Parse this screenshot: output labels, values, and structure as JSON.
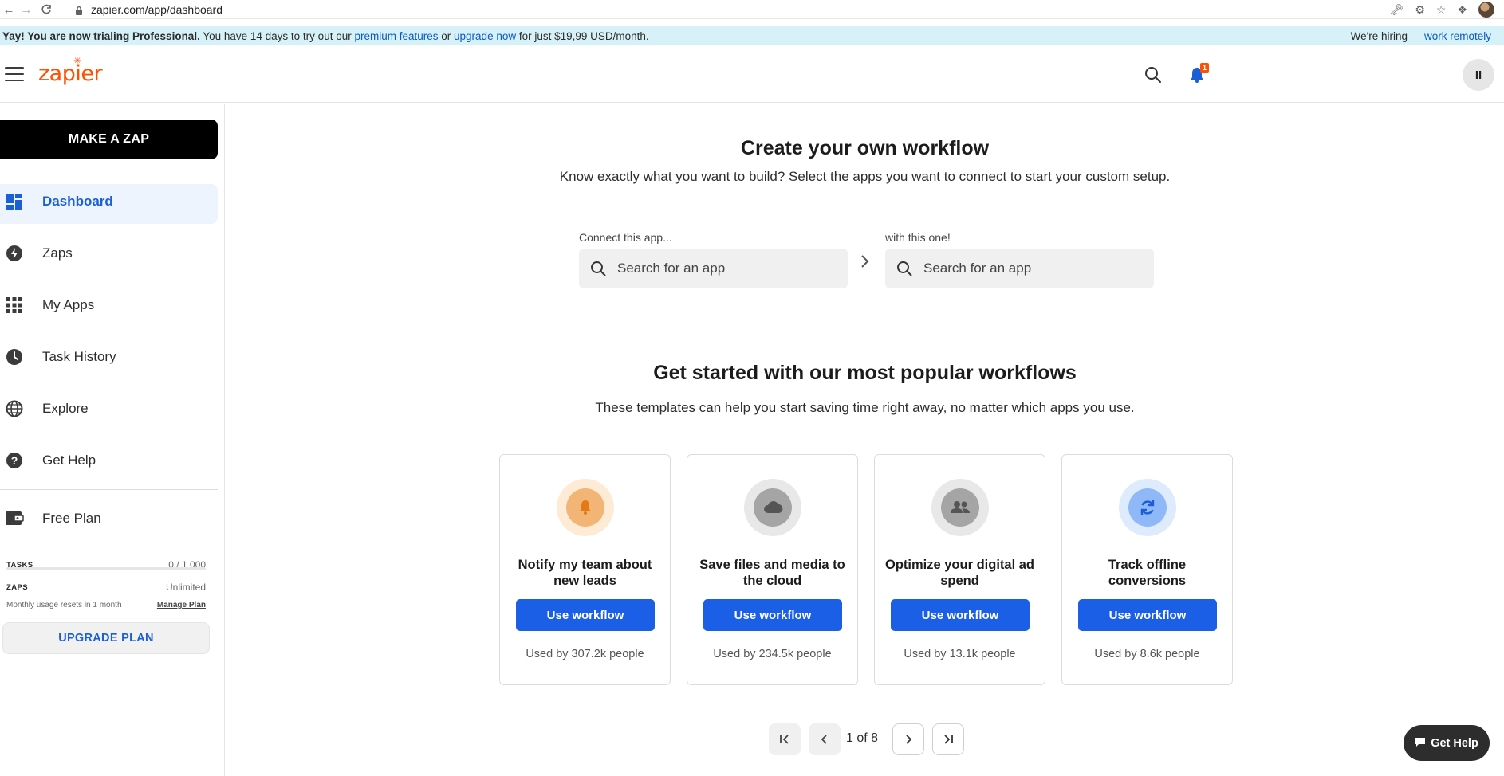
{
  "browser": {
    "url": "zapier.com/app/dashboard"
  },
  "banner": {
    "strong": "Yay! You are now trialing Professional.",
    "text1": " You have 14 days to try out our ",
    "link1": "premium features",
    "text2": " or ",
    "link2": "upgrade now",
    "text3": " for just $19,99 USD/month.",
    "hiring_text": "We're hiring — ",
    "hiring_link": "work remotely"
  },
  "header": {
    "logo": "zapier",
    "notification_count": "1",
    "avatar_initials": "II"
  },
  "sidebar": {
    "make_zap": "MAKE A ZAP",
    "items": [
      {
        "label": "Dashboard",
        "icon": "dashboard-icon",
        "active": true
      },
      {
        "label": "Zaps",
        "icon": "bolt-icon"
      },
      {
        "label": "My Apps",
        "icon": "apps-grid-icon"
      },
      {
        "label": "Task History",
        "icon": "clock-icon"
      },
      {
        "label": "Explore",
        "icon": "globe-icon"
      },
      {
        "label": "Get Help",
        "icon": "help-icon"
      }
    ],
    "plan": {
      "name": "Free Plan",
      "tasks_label": "TASKS",
      "tasks_value": "0 / 1 000",
      "tasks_progress": 0.0,
      "zaps_label": "ZAPS",
      "zaps_value": "Unlimited",
      "reset_text": "Monthly usage resets in 1 month",
      "manage_link": "Manage Plan",
      "upgrade_button": "UPGRADE PLAN"
    }
  },
  "main": {
    "create": {
      "title": "Create your own workflow",
      "subtitle": "Know exactly what you want to build? Select the apps you want to connect to start your custom setup.",
      "left_label": "Connect this app...",
      "right_label": "with this one!",
      "placeholder": "Search for an app"
    },
    "popular": {
      "title": "Get started with our most popular workflows",
      "subtitle": "These templates can help you start saving time right away, no matter which apps you use.",
      "cards": [
        {
          "title": "Notify my team about new leads",
          "button": "Use workflow",
          "used": "Used by 307.2k people",
          "icon": "bell-icon",
          "color": "#f0a04b"
        },
        {
          "title": "Save files and media to the cloud",
          "button": "Use workflow",
          "used": "Used by 234.5k people",
          "icon": "cloud-icon",
          "color": "#8a8a8a"
        },
        {
          "title": "Optimize your digital ad spend",
          "button": "Use workflow",
          "used": "Used by 13.1k people",
          "icon": "people-icon",
          "color": "#8a8a8a"
        },
        {
          "title": "Track offline conversions",
          "button": "Use workflow",
          "used": "Used by 8.6k people",
          "icon": "sync-icon",
          "color": "#4c8cf5"
        }
      ]
    },
    "pager": {
      "indicator": "1 of 8"
    }
  },
  "floating_help": {
    "label": "Get Help"
  }
}
